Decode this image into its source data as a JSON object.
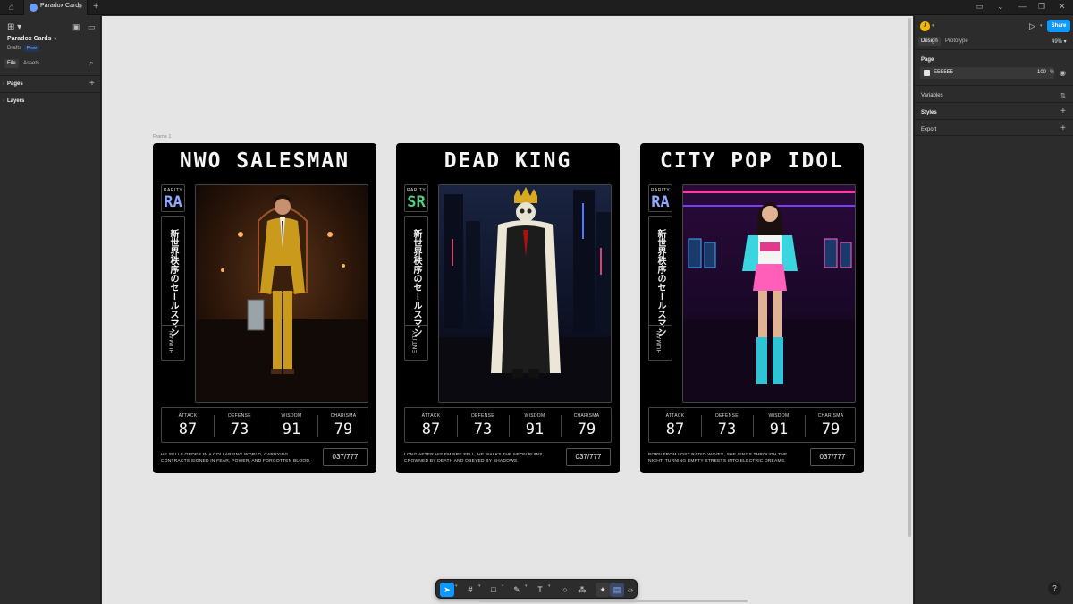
{
  "tabbar": {
    "home_icon": "home-icon",
    "tab_title": "Paradox Cards",
    "tab_close": "×",
    "new_tab": "+"
  },
  "left_panel": {
    "file_name": "Paradox Cards",
    "location": "Drafts",
    "plan_badge": "Free",
    "tabs": [
      "File",
      "Assets"
    ],
    "sections": [
      "Pages",
      "Layers"
    ]
  },
  "canvas": {
    "background": "#E5E5E5",
    "frame_label": "Frame 1",
    "cards": [
      {
        "title": "NWO SALESMAN",
        "rarity_label": "RARITY",
        "rarity": "RA",
        "rarity_color": "#8ea8ff",
        "jp_text": "新世界秩序のセールスマン",
        "type": "HUMAN",
        "art": "salesman-art",
        "stats": [
          {
            "label": "ATTACK",
            "value": "87"
          },
          {
            "label": "DEFENSE",
            "value": "73"
          },
          {
            "label": "WISDOM",
            "value": "91"
          },
          {
            "label": "CHARISMA",
            "value": "79"
          }
        ],
        "description": "HE SELLS ORDER IN A COLLAPSING WORLD, CARRYING CONTRACTS SIGNED IN FEAR, POWER, AND FORGOTTEN BLOOD.",
        "serial": "037/777"
      },
      {
        "title": "DEAD KING",
        "rarity_label": "RARITY",
        "rarity": "SR",
        "rarity_color": "#4fcf84",
        "jp_text": "新世界秩序のセールスマン",
        "type": "ENTITY",
        "art": "dead-king-art",
        "stats": [
          {
            "label": "ATTACK",
            "value": "87"
          },
          {
            "label": "DEFENSE",
            "value": "73"
          },
          {
            "label": "WISDOM",
            "value": "91"
          },
          {
            "label": "CHARISMA",
            "value": "79"
          }
        ],
        "description": "LONG AFTER HIS EMPIRE FELL, HE WALKS THE NEON RUINS, CROWNED BY DEATH AND OBEYED BY SHADOWS.",
        "serial": "037/777"
      },
      {
        "title": "CITY POP IDOL",
        "rarity_label": "RARITY",
        "rarity": "RA",
        "rarity_color": "#8ea8ff",
        "jp_text": "新世界秩序のセールスマン",
        "type": "HUMAN",
        "art": "city-pop-idol-art",
        "stats": [
          {
            "label": "ATTACK",
            "value": "87"
          },
          {
            "label": "DEFENSE",
            "value": "73"
          },
          {
            "label": "WISDOM",
            "value": "91"
          },
          {
            "label": "CHARISMA",
            "value": "79"
          }
        ],
        "description": "BORN FROM LOST RADIO WAVES, SHE SINGS THROUGH THE NIGHT, TURNING EMPTY STREETS INTO ELECTRIC DREAMS.",
        "serial": "037/777"
      }
    ]
  },
  "toolbar": {
    "tools": [
      "move-tool-icon",
      "frame-tool-icon",
      "shape-tool-icon",
      "pen-tool-icon",
      "text-tool-icon",
      "comment-tool-icon",
      "actions-icon",
      "draw-mode-icon",
      "design-mode-icon",
      "dev-mode-icon"
    ],
    "text_tool": "T"
  },
  "right_panel": {
    "avatar_letter": "J",
    "share_label": "Share",
    "tabs": [
      "Design",
      "Prototype"
    ],
    "zoom": "49%",
    "page_section": "Page",
    "page_color": "E5E5E5",
    "page_opacity": "100",
    "percent_sign": "%",
    "sections": [
      "Variables",
      "Styles",
      "Export"
    ],
    "accent_color": "#0D99FF"
  },
  "help_label": "?"
}
